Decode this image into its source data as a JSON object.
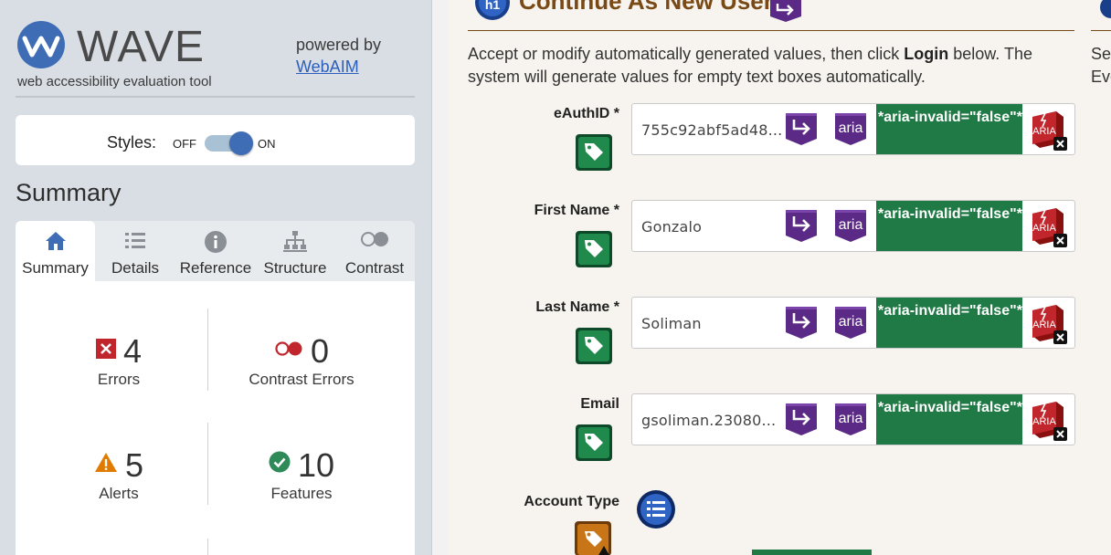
{
  "logo": {
    "name": "WAVE",
    "tagline": "web accessibility evaluation tool",
    "powered_by": "powered by",
    "webaim_link": "WebAIM"
  },
  "styles": {
    "label": "Styles:",
    "off": "OFF",
    "on": "ON",
    "enabled": true
  },
  "summary": {
    "title": "Summary",
    "tabs": [
      {
        "label": "Summary",
        "icon": "home-icon"
      },
      {
        "label": "Details",
        "icon": "list-icon"
      },
      {
        "label": "Reference",
        "icon": "info-icon"
      },
      {
        "label": "Structure",
        "icon": "structure-icon"
      },
      {
        "label": "Contrast",
        "icon": "contrast-icon"
      }
    ],
    "active_tab": "Summary",
    "stats": [
      {
        "count": "4",
        "label": "Errors",
        "icon": "error-icon"
      },
      {
        "count": "0",
        "label": "Contrast Errors",
        "icon": "contrast-error-icon"
      },
      {
        "count": "5",
        "label": "Alerts",
        "icon": "alert-icon"
      },
      {
        "count": "10",
        "label": "Features",
        "icon": "feature-icon"
      }
    ]
  },
  "main": {
    "heading": "Continue As New User",
    "heading_badge": "h1",
    "intro_before": "Accept or modify automatically generated values, then click ",
    "intro_bold": "Login",
    "intro_after": " below. The system will generate values for empty text boxes automatically.",
    "clipped_right": "Sel Eve",
    "aria_badge_text": "aria",
    "error_badge_text": "ARIA",
    "fields": [
      {
        "label": "eAuthID *",
        "value": "755c92abf5ad48...",
        "aria_note": "*aria-invalid=\"false\"*"
      },
      {
        "label": "First Name *",
        "value": "Gonzalo",
        "aria_note": "*aria-invalid=\"false\"*"
      },
      {
        "label": "Last Name *",
        "value": "Soliman",
        "aria_note": "*aria-invalid=\"false\"*"
      },
      {
        "label": "Email",
        "value": "gsoliman.23080...",
        "aria_note": "*aria-invalid=\"false\"*"
      }
    ],
    "account_type_label": "Account Type"
  },
  "colors": {
    "sidebar_bg": "#d9dee5",
    "error_red": "#c0262b",
    "alert_orange": "#e07b00",
    "feature_green": "#2e8b57",
    "aria_green": "#1f7a45",
    "structure_purple": "#5b2a86"
  }
}
